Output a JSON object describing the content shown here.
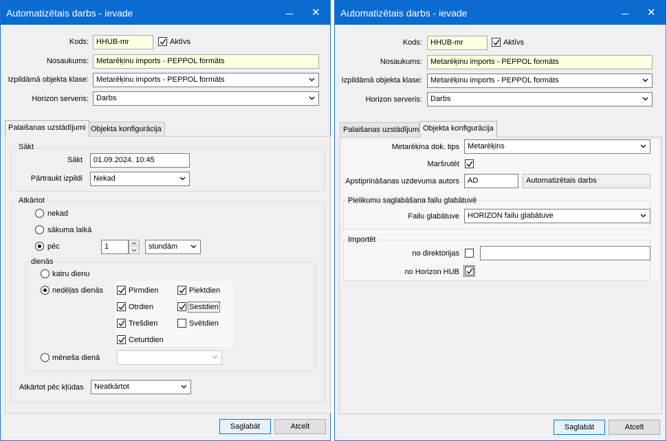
{
  "left_window": {
    "title": "Automatizētais darbs - ievade",
    "fields": {
      "kods_label": "Kods:",
      "kods_value": "HHUB-mr",
      "aktivs_label": "Aktīvs",
      "nosaukums_label": "Nosaukums:",
      "nosaukums_value": "Metarēķinu imports - PEPPOL formāts",
      "klase_label": "Izpildāmā objekta klase:",
      "klase_value": "Metarēķinu imports - PEPPOL formāts",
      "serveris_label": "Horizon serveris:",
      "serveris_value": "Darbs"
    },
    "tabs": [
      "Palaišanas uzstādījumi",
      "Objekta konfigurācija"
    ],
    "sakt_group": {
      "title": "Sākt",
      "sakt_label": "Sākt",
      "sakt_value": "01.09.2024. 10:45",
      "partraukt_label": "Pārtraukt izpildi",
      "partraukt_value": "Nekad"
    },
    "atkartot_group": {
      "title": "Atkārtot",
      "opt_nekad": "nekad",
      "opt_sakuma": "sākuma laikā",
      "opt_pec": "pēc",
      "pec_value": "1",
      "pec_unit": "stundām",
      "dienas_title": "dienās",
      "opt_katru": "katru dienu",
      "opt_nedelas": "nedēļas dienās",
      "days": {
        "pirmdien": "Pirmdien",
        "otrdien": "Otrdien",
        "tresdien": "Trešdien",
        "ceturtdien": "Ceturtdien",
        "piektdien": "Piektdien",
        "sestdien": "Sestdien",
        "svetdien": "Svētdien"
      },
      "opt_menesa": "mēneša dienā",
      "menesa_value": ""
    },
    "kluda_label": "Atkārtot pēc kļūdas",
    "kluda_value": "Neatkārtot",
    "buttons": {
      "save": "Saglabāt",
      "cancel": "Atcelt"
    }
  },
  "right_window": {
    "title": "Automatizētais darbs - ievade",
    "fields": {
      "kods_label": "Kods:",
      "kods_value": "HHUB-mr",
      "aktivs_label": "Aktīvs",
      "nosaukums_label": "Nosaukums:",
      "nosaukums_value": "Metarēķinu imports - PEPPOL formāts",
      "klase_label": "Izpildāmā objekta klase:",
      "klase_value": "Metarēķinu imports - PEPPOL formāts",
      "serveris_label": "Horizon serveris:",
      "serveris_value": "Darbs"
    },
    "tabs": [
      "Palaišanas uzstādījumi",
      "Objekta konfigurācija"
    ],
    "config": {
      "dok_tips_label": "Metarēķina dok. tips",
      "dok_tips_value": "Metarēķins",
      "marsrutet_label": "Maršrutēt",
      "autors_label": "Apstiprināšanas uzdevuma autors",
      "autors_code": "AD",
      "autors_name": "Automatizētais darbs",
      "pielikumu_title": "Pielikumu saglabāšana failu glabātuvē",
      "glabatuve_label": "Failu glabātuve",
      "glabatuve_value": "HORIZON failu glabātuve",
      "importet_title": "Importēt",
      "no_dir_label": "no direktorijas",
      "no_dir_value": "",
      "no_hub_label": "no Horizon HUB"
    },
    "buttons": {
      "save": "Saglabāt",
      "cancel": "Atcelt"
    }
  },
  "colors": {
    "titlebar": "#0a6bd1",
    "highlight_field": "#ffffe1",
    "primary_button_border": "#0078d7"
  },
  "icons": [
    "minimize-icon",
    "close-icon",
    "chevron-down-icon",
    "checkmark-icon",
    "spin-up-icon",
    "spin-down-icon"
  ]
}
